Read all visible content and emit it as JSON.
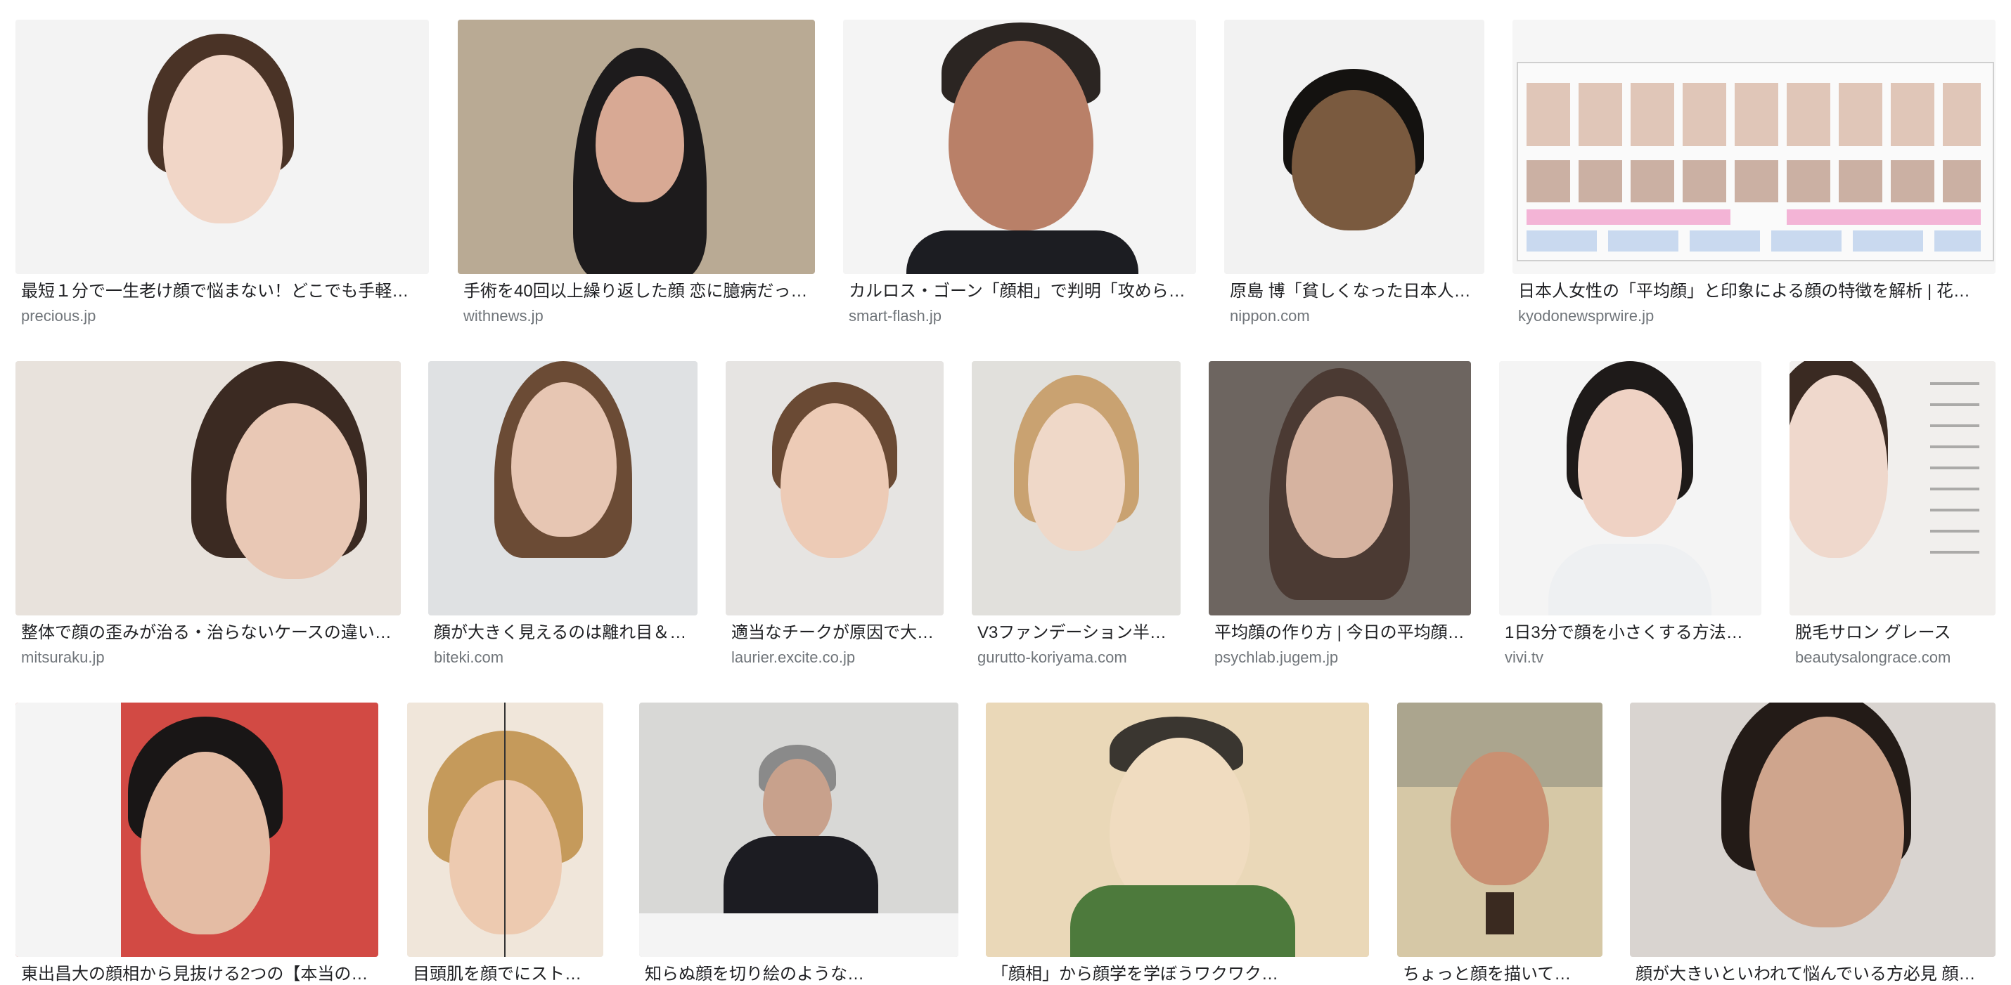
{
  "results": [
    {
      "caption": "最短１分で一生老け顔で悩まない！どこでも手軽…",
      "source": "precious.jp",
      "bg": "#f3f3f3",
      "skin": "#f1d6c7",
      "hair": "#4a3326"
    },
    {
      "caption": "手術を40回以上繰り返した顔 恋に臆病だっ…",
      "source": "withnews.jp",
      "bg": "#b9aa94",
      "skin": "#d8a994",
      "hair": "#1d1b1c"
    },
    {
      "caption": "カルロス・ゴーン「顔相」で判明「攻めら…",
      "source": "smart-flash.jp",
      "bg": "#f4f4f4",
      "skin": "#b98068",
      "hair": "#2b2522"
    },
    {
      "caption": "原島 博「貧しくなった日本人…",
      "source": "nippon.com",
      "bg": "#f2f2f2",
      "skin": "#7a5a3f",
      "hair": "#141210"
    },
    {
      "caption": "日本人女性の「平均顔」と印象による顔の特徴を解析 | 花…",
      "source": "kyodonewsprwire.jp",
      "bg": "#f6f6f6",
      "skin": "#d9bcae",
      "hair": "#3a2a24"
    },
    {
      "caption": "整体で顔の歪みが治る・治らないケースの違い…",
      "source": "mitsuraku.jp",
      "bg": "#e8e2dc",
      "skin": "#e9c8b5",
      "hair": "#3b2a22"
    },
    {
      "caption": "顔が大きく見えるのは離れ目＆…",
      "source": "biteki.com",
      "bg": "#dfe1e3",
      "skin": "#e7c6b3",
      "hair": "#6b4b35"
    },
    {
      "caption": "適当なチークが原因で大…",
      "source": "laurier.excite.co.jp",
      "bg": "#e6e4e2",
      "skin": "#edcbb6",
      "hair": "#6a4a34"
    },
    {
      "caption": "V3ファンデーション半…",
      "source": "gurutto-koriyama.com",
      "bg": "#e1e0dc",
      "skin": "#efd8c8",
      "hair": "#c9a271"
    },
    {
      "caption": "平均顔の作り方 | 今日の平均顔…",
      "source": "psychlab.jugem.jp",
      "bg": "#6d6560",
      "skin": "#d6b3a0",
      "hair": "#4b3a33"
    },
    {
      "caption": "1日3分で顔を小さくする方法…",
      "source": "vivi.tv",
      "bg": "#f4f4f4",
      "skin": "#efd2c4",
      "hair": "#1e1a19"
    },
    {
      "caption": "脱毛サロン グレース",
      "source": "beautysalongrace.com",
      "bg": "#f1efed",
      "skin": "#efd8cc",
      "hair": "#3a2a22"
    },
    {
      "caption": "東出昌大の顔相から見抜ける2つの【本当の…",
      "source": "",
      "bg": "#d24a44",
      "skin": "#e4bca4",
      "hair": "#191616"
    },
    {
      "caption": "目頭肌を顔でにストレスを与えて…",
      "source": "",
      "bg": "#f0e6da",
      "skin": "#edcab0",
      "hair": "#c59a5b"
    },
    {
      "caption": "知らぬ顔を切り絵のような…",
      "source": "",
      "bg": "#d8d8d6",
      "skin": "#c8a18c",
      "hair": "#8a8a8a"
    },
    {
      "caption": "「顔相」から顔学を学ぼうワクワク…",
      "source": "",
      "bg": "#ead8b8",
      "skin": "#f0dcc0",
      "hair": "#3a3630"
    },
    {
      "caption": "ちょっと顔を描いて…",
      "source": "",
      "bg": "#d6c8a6",
      "skin": "#c99072",
      "hair": "#6a4630"
    },
    {
      "caption": "顔が大きいといわれて悩んでいる方必見 顔を小さ…",
      "source": "",
      "bg": "#d9d4d0",
      "skin": "#cfa58d",
      "hair": "#231b17"
    }
  ]
}
